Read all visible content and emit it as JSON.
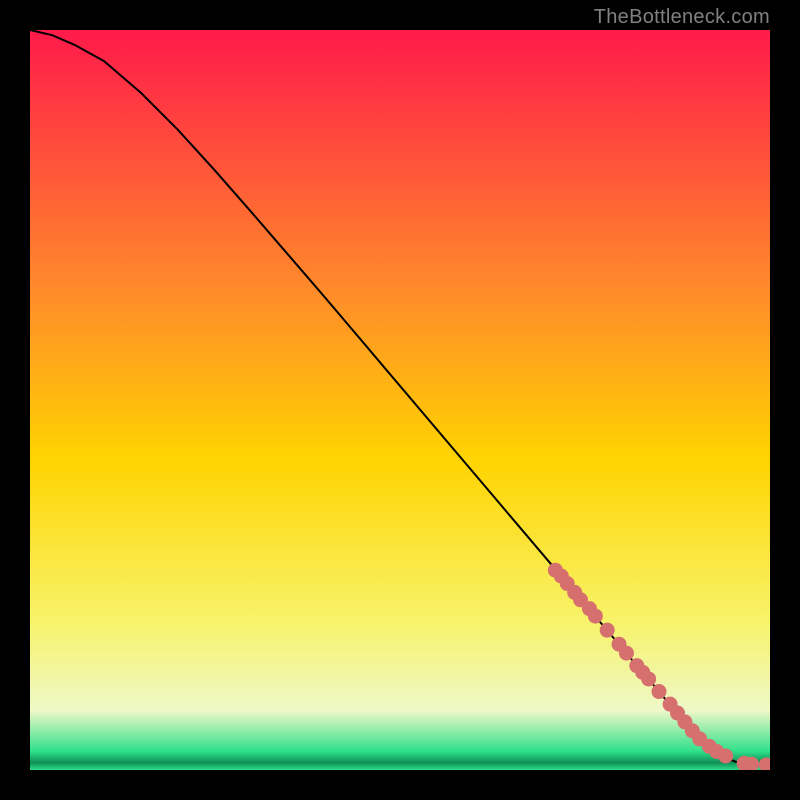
{
  "watermark": "TheBottleneck.com",
  "chart_data": {
    "type": "line",
    "title": "",
    "xlabel": "",
    "ylabel": "",
    "xlim": [
      0,
      100
    ],
    "ylim": [
      0,
      100
    ],
    "curve": {
      "x": [
        0,
        3,
        6,
        10,
        15,
        20,
        25,
        30,
        35,
        40,
        45,
        50,
        55,
        60,
        65,
        70,
        75,
        80,
        82,
        84,
        86,
        88,
        90,
        92,
        94,
        96,
        98,
        100
      ],
      "y": [
        100,
        99.3,
        98.0,
        95.8,
        91.5,
        86.5,
        81.0,
        75.3,
        69.5,
        63.7,
        57.8,
        51.9,
        46.0,
        40.1,
        34.2,
        28.3,
        22.4,
        16.5,
        14.1,
        11.8,
        9.4,
        7.0,
        4.7,
        2.9,
        1.6,
        0.9,
        0.7,
        0.7
      ]
    },
    "markers": {
      "x": [
        71.0,
        71.8,
        72.6,
        73.6,
        74.4,
        75.6,
        76.4,
        78.0,
        79.6,
        80.6,
        82.0,
        82.8,
        83.6,
        85.0,
        86.5,
        87.5,
        88.5,
        89.5,
        90.5,
        91.8,
        92.8,
        94.0,
        96.5,
        97.5,
        99.5,
        100.5
      ],
      "y": [
        27.0,
        26.2,
        25.2,
        24.0,
        23.0,
        21.8,
        20.8,
        18.9,
        17.0,
        15.8,
        14.1,
        13.2,
        12.3,
        10.6,
        8.9,
        7.7,
        6.5,
        5.3,
        4.2,
        3.2,
        2.5,
        1.9,
        0.9,
        0.8,
        0.7,
        0.7
      ]
    },
    "gradient_colors": {
      "top": "#FF1A4A",
      "upper_mid": "#FF8A2A",
      "mid": "#FFD400",
      "lower_mid": "#F7F36A",
      "pale": "#EEF8C8",
      "green": "#2EE08A",
      "thin_dark": "#0F8F55"
    },
    "marker_color": "#D6706F",
    "curve_color": "#000000"
  }
}
